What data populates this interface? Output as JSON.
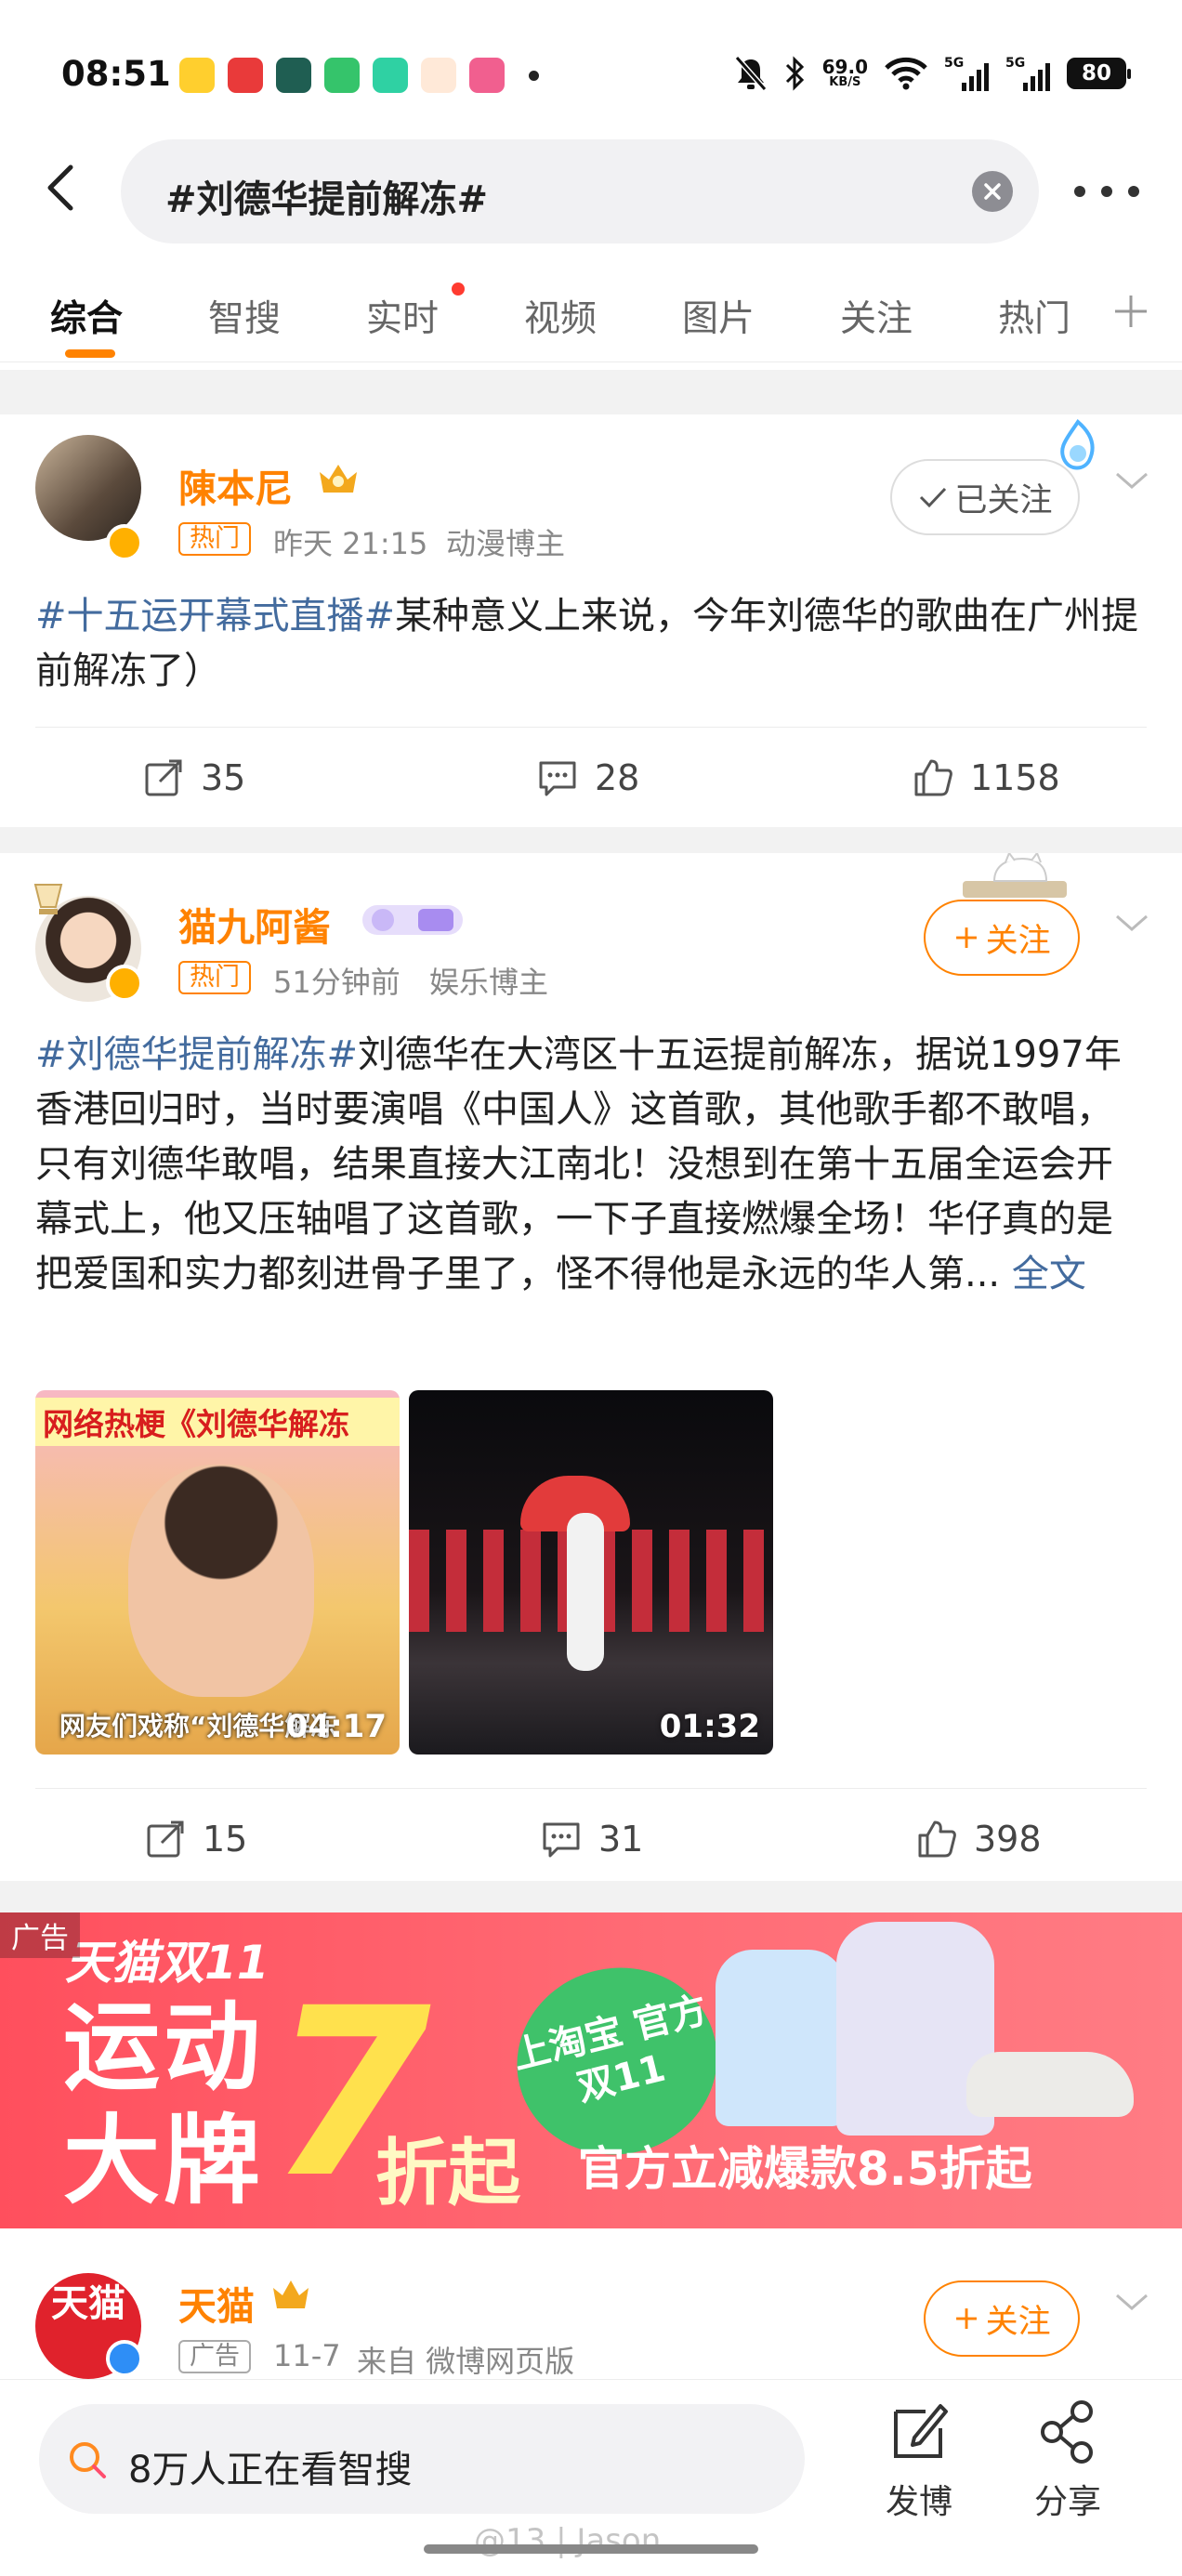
{
  "status_bar": {
    "time": "08:51",
    "net_speed": "69.0",
    "net_unit": "KB/S",
    "sig1": "5G",
    "sig2": "5G",
    "battery": "80"
  },
  "search": {
    "query": "#刘德华提前解冻#"
  },
  "tabs": [
    "综合",
    "智搜",
    "实时",
    "视频",
    "图片",
    "关注",
    "热门"
  ],
  "posts": [
    {
      "user": "陳本尼",
      "tag": "热门",
      "time": "昨天 21:15",
      "role": "动漫博主",
      "follow_label": "已关注",
      "topic": "#十五运开幕式直播#",
      "text": "某种意义上来说，今年刘德华的歌曲在广州提前解冻了）",
      "reposts": "35",
      "comments": "28",
      "likes": "1158"
    },
    {
      "user": "猫九阿酱",
      "tag": "热门",
      "time": "51分钟前",
      "role": "娱乐博主",
      "follow_label": "关注",
      "topic": "#刘德华提前解冻#",
      "text": "刘德华在大湾区十五运提前解冻，据说1997年香港回归时，当时要演唱《中国人》这首歌，其他歌手都不敢唱，只有刘德华敢唱，结果直接大江南北！没想到在第十五届全运会开幕式上，他又压轴唱了这首歌，一下子直接燃爆全场！华仔真的是把爱国和实力都刻进骨子里了，怪不得他是永远的华人第...",
      "more": "全文",
      "media": [
        {
          "caption_top": "网络热梗《刘德华解冻",
          "caption_bottom": "网友们戏称“刘德华解冻",
          "duration": "04:17"
        },
        {
          "caption_top": "",
          "caption_bottom": "",
          "duration": "01:32"
        }
      ],
      "reposts": "15",
      "comments": "31",
      "likes": "398"
    }
  ],
  "ad_banner": {
    "label": "广告",
    "brand": "天猫双11",
    "line1": "运动",
    "line2": "大牌",
    "big_number": "7",
    "discount": "折起",
    "badge": "上淘宝 官方双11",
    "slogan": "官方立减爆款8.5折起"
  },
  "ad_post": {
    "user": "天猫",
    "tag": "广告",
    "time": "11-7",
    "source": "来自 微博网页版",
    "follow_label": "关注"
  },
  "bottom_bar": {
    "search_text": "8万人正在看智搜",
    "post_label": "发博",
    "share_label": "分享",
    "watermark": "@13 | Jason"
  },
  "colors": {
    "accent": "#ff8200",
    "topic_link": "#436b9e",
    "banner_red": "#ff4f5d"
  },
  "icons": [
    "back-icon",
    "clear-icon",
    "more-icon",
    "plus-icon",
    "repost-icon",
    "comment-icon",
    "like-icon",
    "search-icon",
    "compose-icon",
    "share-icon",
    "chevron-down-icon",
    "check-icon"
  ]
}
